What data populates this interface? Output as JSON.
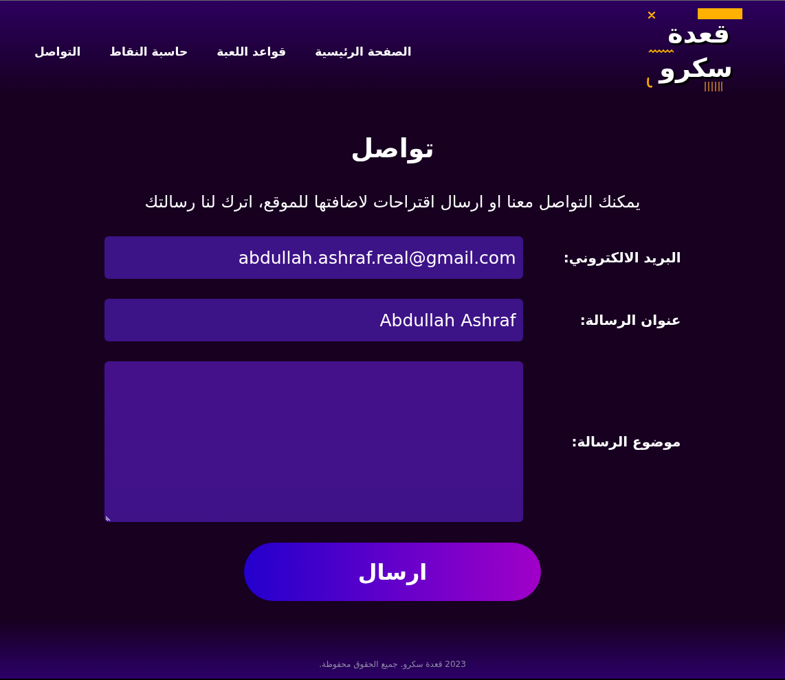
{
  "header": {
    "logo": {
      "line_1": "قعدة",
      "line_2": "سكرو"
    },
    "nav": [
      "الصفحة الرئيسية",
      "قواعد اللعبة",
      "حاسبة النقاط",
      "التواصل"
    ]
  },
  "page": {
    "title": "تواصل",
    "intro": "يمكنك التواصل معنا او ارسال اقتراحات لاضافتها للموقع، اترك لنا رسالتك"
  },
  "form": {
    "fields": [
      {
        "kind": "input",
        "label": "البريد الالكتروني:",
        "value": "abdullah.ashraf.real@gmail.com"
      },
      {
        "kind": "input",
        "label": "عنوان الرسالة:",
        "value": "Abdullah Ashraf"
      },
      {
        "kind": "textarea",
        "label": "موضوع الرسالة:"
      }
    ],
    "submit": "ارسال"
  },
  "footer": {
    "copyright": "2023 قعدة سكرو. جميع الحقوق محفوظة."
  }
}
